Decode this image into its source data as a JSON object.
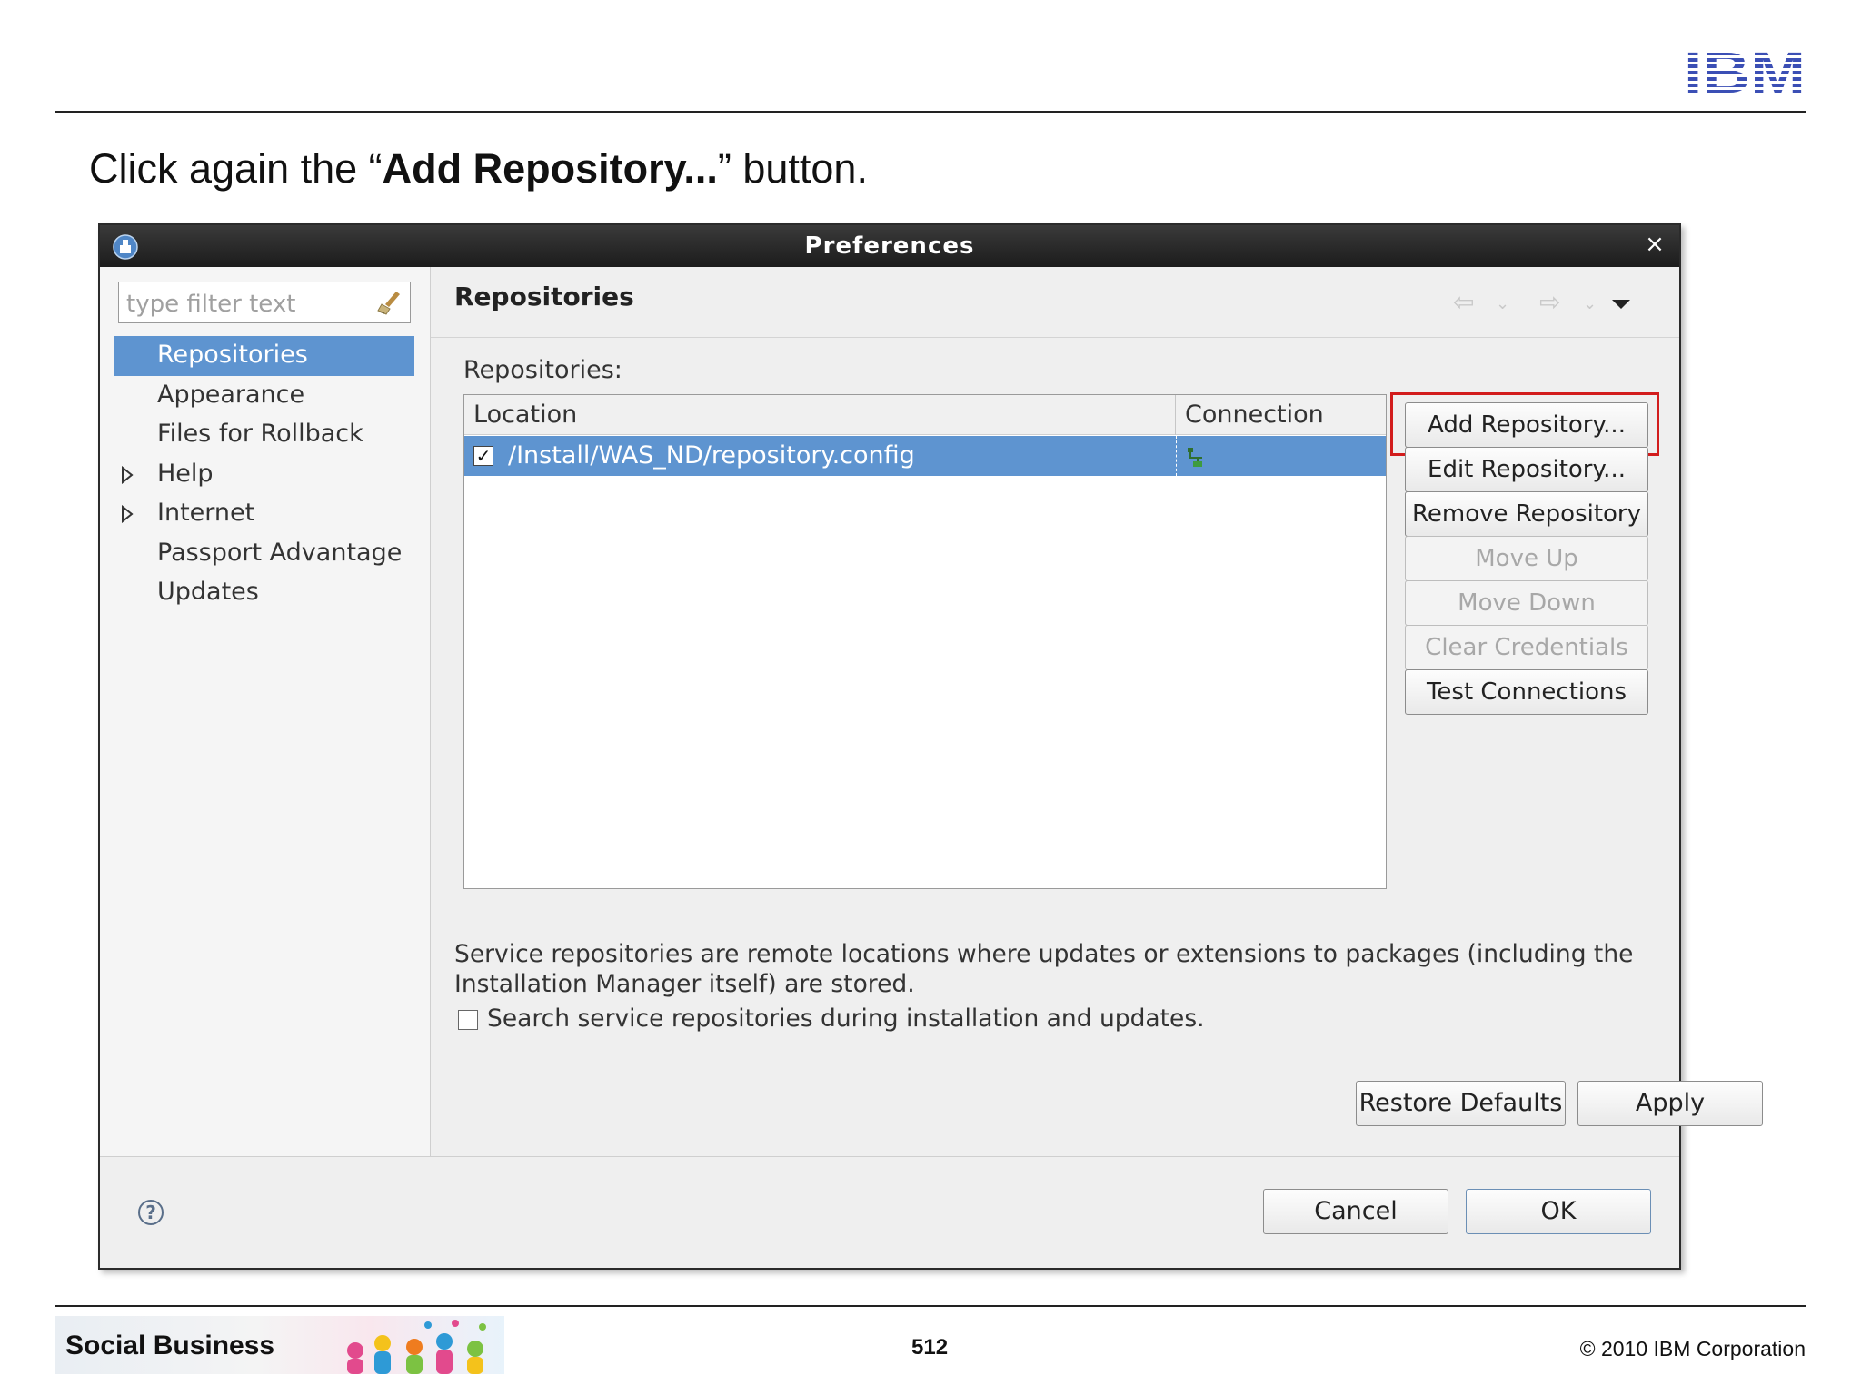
{
  "slide": {
    "logo_text": "IBM",
    "instruction_prefix": "Click again the “",
    "instruction_bold": "Add Repository...",
    "instruction_suffix": "” button.",
    "footer_brand": "Social Business",
    "page_number": "512",
    "copyright": "© 2010 IBM Corporation"
  },
  "dialog": {
    "title": "Preferences",
    "filter_placeholder": "type filter text",
    "nav_items": [
      {
        "label": "Repositories",
        "selected": true,
        "expandable": false
      },
      {
        "label": "Appearance",
        "selected": false,
        "expandable": false
      },
      {
        "label": "Files for Rollback",
        "selected": false,
        "expandable": false
      },
      {
        "label": "Help",
        "selected": false,
        "expandable": true
      },
      {
        "label": "Internet",
        "selected": false,
        "expandable": true
      },
      {
        "label": "Passport Advantage",
        "selected": false,
        "expandable": false
      },
      {
        "label": "Updates",
        "selected": false,
        "expandable": false
      }
    ],
    "page_title": "Repositories",
    "repositories_label": "Repositories:",
    "table": {
      "columns": [
        "Location",
        "Connection"
      ],
      "rows": [
        {
          "checked": true,
          "location": "/Install/WAS_ND/repository.config",
          "connection_icon": "connection-ok-icon"
        }
      ]
    },
    "side_buttons": [
      {
        "label": "Add Repository...",
        "enabled": true,
        "highlighted": true
      },
      {
        "label": "Edit Repository...",
        "enabled": true
      },
      {
        "label": "Remove Repository",
        "enabled": true
      },
      {
        "label": "Move Up",
        "enabled": false
      },
      {
        "label": "Move Down",
        "enabled": false
      },
      {
        "label": "Clear Credentials",
        "enabled": false
      },
      {
        "label": "Test Connections",
        "enabled": true
      }
    ],
    "description": "Service repositories are remote locations where updates or extensions to packages (including the Installation Manager itself) are stored.",
    "search_checkbox_label": "Search service repositories during installation and updates.",
    "search_checkbox_checked": false,
    "restore_defaults_label": "Restore Defaults",
    "apply_label": "Apply",
    "cancel_label": "Cancel",
    "ok_label": "OK",
    "help_glyph": "?",
    "close_glyph": "×"
  },
  "colors": {
    "selection_blue": "#5e94d0",
    "titlebar": "#1c1c1c",
    "highlight_red": "#d21c1c",
    "ibm_blue": "#3b4fb5"
  }
}
